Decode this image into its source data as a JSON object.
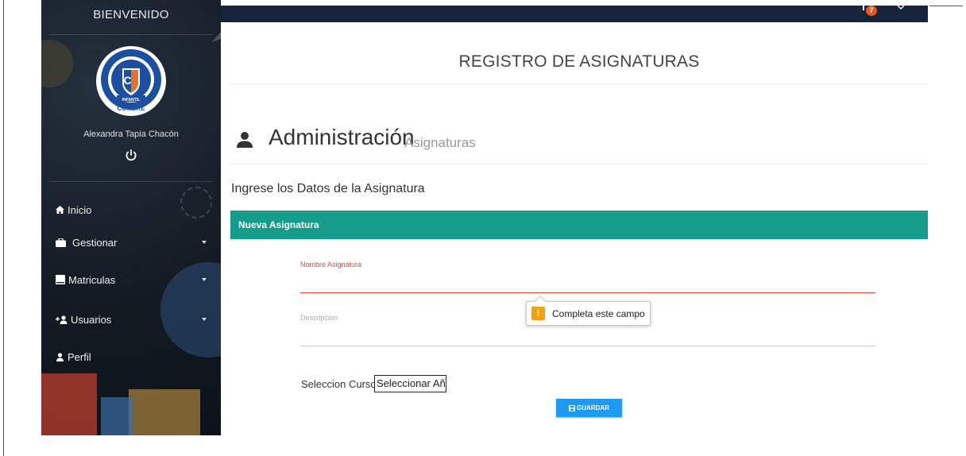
{
  "sidebar": {
    "welcome": "BIENVENIDO",
    "logo_text": "CUMBRE",
    "user_name": "Alexandra Tapia Chacón",
    "items": [
      {
        "label": "Inicio",
        "icon": "home-icon"
      },
      {
        "label": "Gestionar",
        "icon": "briefcase-icon"
      },
      {
        "label": "Matriculas",
        "icon": "book-icon"
      },
      {
        "label": "Usuarios",
        "icon": "user-plus-icon"
      },
      {
        "label": "Perfil",
        "icon": "user-icon"
      }
    ]
  },
  "topbar": {
    "badge_count": "7",
    "background": "#17233a"
  },
  "main": {
    "page_title": "REGISTRO DE ASIGNATURAS",
    "admin_title": "Administración",
    "admin_subtitle": "Asignaturas",
    "form_heading": "Ingrese los Datos de la Asignatura",
    "panel_title": "Nueva Asignatura",
    "panel_color": "#159c8a",
    "field_name_label": "Nombre Asignatura",
    "field_name_value": "",
    "field_desc_label": "Descripcion",
    "field_desc_value": "",
    "validation_tooltip": "Completa este campo",
    "select_label": "Seleccion Curso:",
    "select_value": "Seleccionar Año",
    "save_button": "GUARDAR",
    "save_button_color": "#1e9af0"
  }
}
